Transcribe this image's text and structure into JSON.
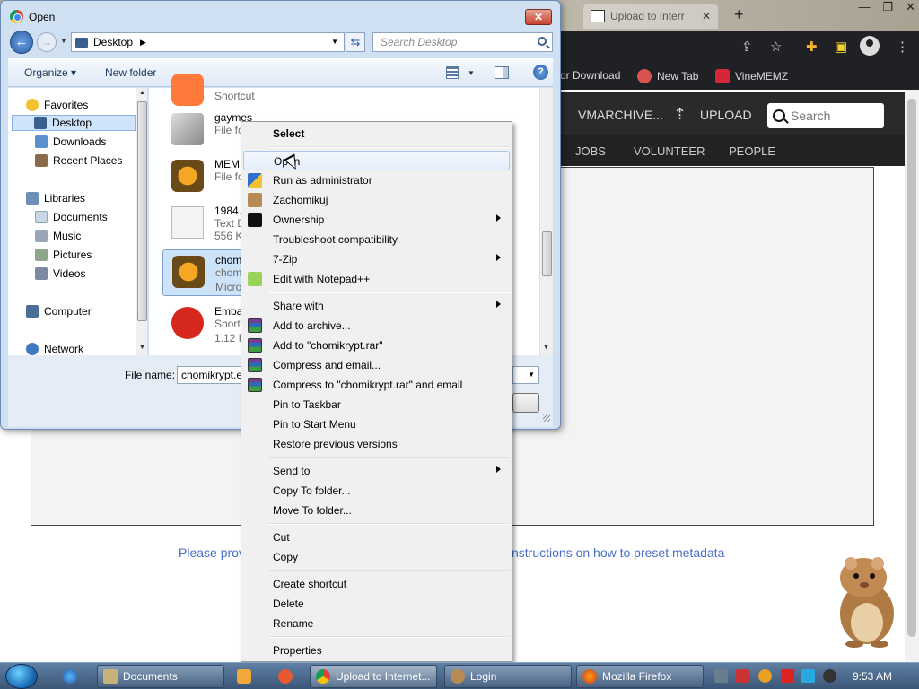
{
  "browser": {
    "tab_title": "Upload to Interr",
    "tab_close": "✕",
    "new_tab": "+",
    "window_controls": [
      "—",
      "❐",
      "✕"
    ],
    "bookmarks": [
      "or Download",
      "New Tab",
      "VineMEMZ"
    ],
    "site": {
      "logo_text": "VMARCHIVE...",
      "upload_label": "UPLOAD",
      "search_placeholder": "Search",
      "nav": [
        "JOBS",
        "VOLUNTEER",
        "PEOPLE"
      ],
      "metadata_text_left": "Please prov",
      "metadata_text_right": "nstructions on how to preset metadata"
    }
  },
  "dialog": {
    "title": "Open",
    "close": "✕",
    "address": "Desktop",
    "search_placeholder": "Search Desktop",
    "toolbar": {
      "organize": "Organize ▾",
      "new_folder": "New folder",
      "help": "?"
    },
    "nav_pane": {
      "items": [
        {
          "label": "Favorites",
          "icon": "star-icon"
        },
        {
          "label": "Desktop",
          "icon": "desktop-icon"
        },
        {
          "label": "Downloads",
          "icon": "downloads-icon"
        },
        {
          "label": "Recent Places",
          "icon": "recent-places-icon"
        },
        {
          "label": "Libraries",
          "icon": "libraries-icon"
        },
        {
          "label": "Documents",
          "icon": "documents-icon"
        },
        {
          "label": "Music",
          "icon": "music-icon"
        },
        {
          "label": "Pictures",
          "icon": "pictures-icon"
        },
        {
          "label": "Videos",
          "icon": "videos-icon"
        },
        {
          "label": "Computer",
          "icon": "computer-icon"
        },
        {
          "label": "Network",
          "icon": "network-icon"
        }
      ]
    },
    "files": [
      {
        "name": "",
        "meta1": "Shortcut",
        "meta2": ""
      },
      {
        "name": "gaymes",
        "meta1": "File fo",
        "meta2": ""
      },
      {
        "name": "MEM",
        "meta1": "File fo",
        "meta2": ""
      },
      {
        "name": "1984.t",
        "meta1": "Text D",
        "meta2": "556 K"
      },
      {
        "name": "chom",
        "meta1": "chom",
        "meta2": "Micro"
      },
      {
        "name": "Emba",
        "meta1": "Short",
        "meta2": "1.12 K"
      }
    ],
    "filename_label": "File name:",
    "filename_value": "chomikrypt.e"
  },
  "context_menu": {
    "items": [
      {
        "label": "Select",
        "icon": "",
        "submenu": false
      },
      {
        "label": "Open",
        "icon": "",
        "submenu": false
      },
      {
        "label": "Run as administrator",
        "icon": "shield-icon",
        "submenu": false
      },
      {
        "label": "Zachomikuj",
        "icon": "hamster-icon",
        "submenu": false
      },
      {
        "label": "Ownership",
        "icon": "console-icon",
        "submenu": true
      },
      {
        "label": "Troubleshoot compatibility",
        "icon": "",
        "submenu": false
      },
      {
        "label": "7-Zip",
        "icon": "",
        "submenu": true
      },
      {
        "label": "Edit with Notepad++",
        "icon": "notepad-icon",
        "submenu": false
      },
      {
        "label": "Share with",
        "icon": "",
        "submenu": true
      },
      {
        "label": "Add to archive...",
        "icon": "winrar-icon",
        "submenu": false
      },
      {
        "label": "Add to \"chomikrypt.rar\"",
        "icon": "winrar-icon",
        "submenu": false
      },
      {
        "label": "Compress and email...",
        "icon": "winrar-icon",
        "submenu": false
      },
      {
        "label": "Compress to \"chomikrypt.rar\" and email",
        "icon": "winrar-icon",
        "submenu": false
      },
      {
        "label": "Pin to Taskbar",
        "icon": "",
        "submenu": false
      },
      {
        "label": "Pin to Start Menu",
        "icon": "",
        "submenu": false
      },
      {
        "label": "Restore previous versions",
        "icon": "",
        "submenu": false
      },
      {
        "label": "Send to",
        "icon": "",
        "submenu": true
      },
      {
        "label": "Copy To folder...",
        "icon": "",
        "submenu": false
      },
      {
        "label": "Move To folder...",
        "icon": "",
        "submenu": false
      },
      {
        "label": "Cut",
        "icon": "",
        "submenu": false
      },
      {
        "label": "Copy",
        "icon": "",
        "submenu": false
      },
      {
        "label": "Create shortcut",
        "icon": "",
        "submenu": false
      },
      {
        "label": "Delete",
        "icon": "",
        "submenu": false
      },
      {
        "label": "Rename",
        "icon": "",
        "submenu": false
      },
      {
        "label": "Properties",
        "icon": "",
        "submenu": false
      }
    ]
  },
  "taskbar": {
    "tasks": [
      {
        "label": "Documents",
        "icon": "folder-icon"
      },
      {
        "label": "Upload to Internet...",
        "icon": "chrome-icon"
      },
      {
        "label": "Login",
        "icon": "hamster-icon"
      },
      {
        "label": "Mozilla Firefox",
        "icon": "firefox-icon"
      }
    ],
    "clock": "9:53 AM"
  },
  "colors": {
    "dialog_frame": "#cfe0f2",
    "selection": "#cde3fa",
    "taskbar": "#4a6688",
    "link_text": "#4a6ec5"
  }
}
